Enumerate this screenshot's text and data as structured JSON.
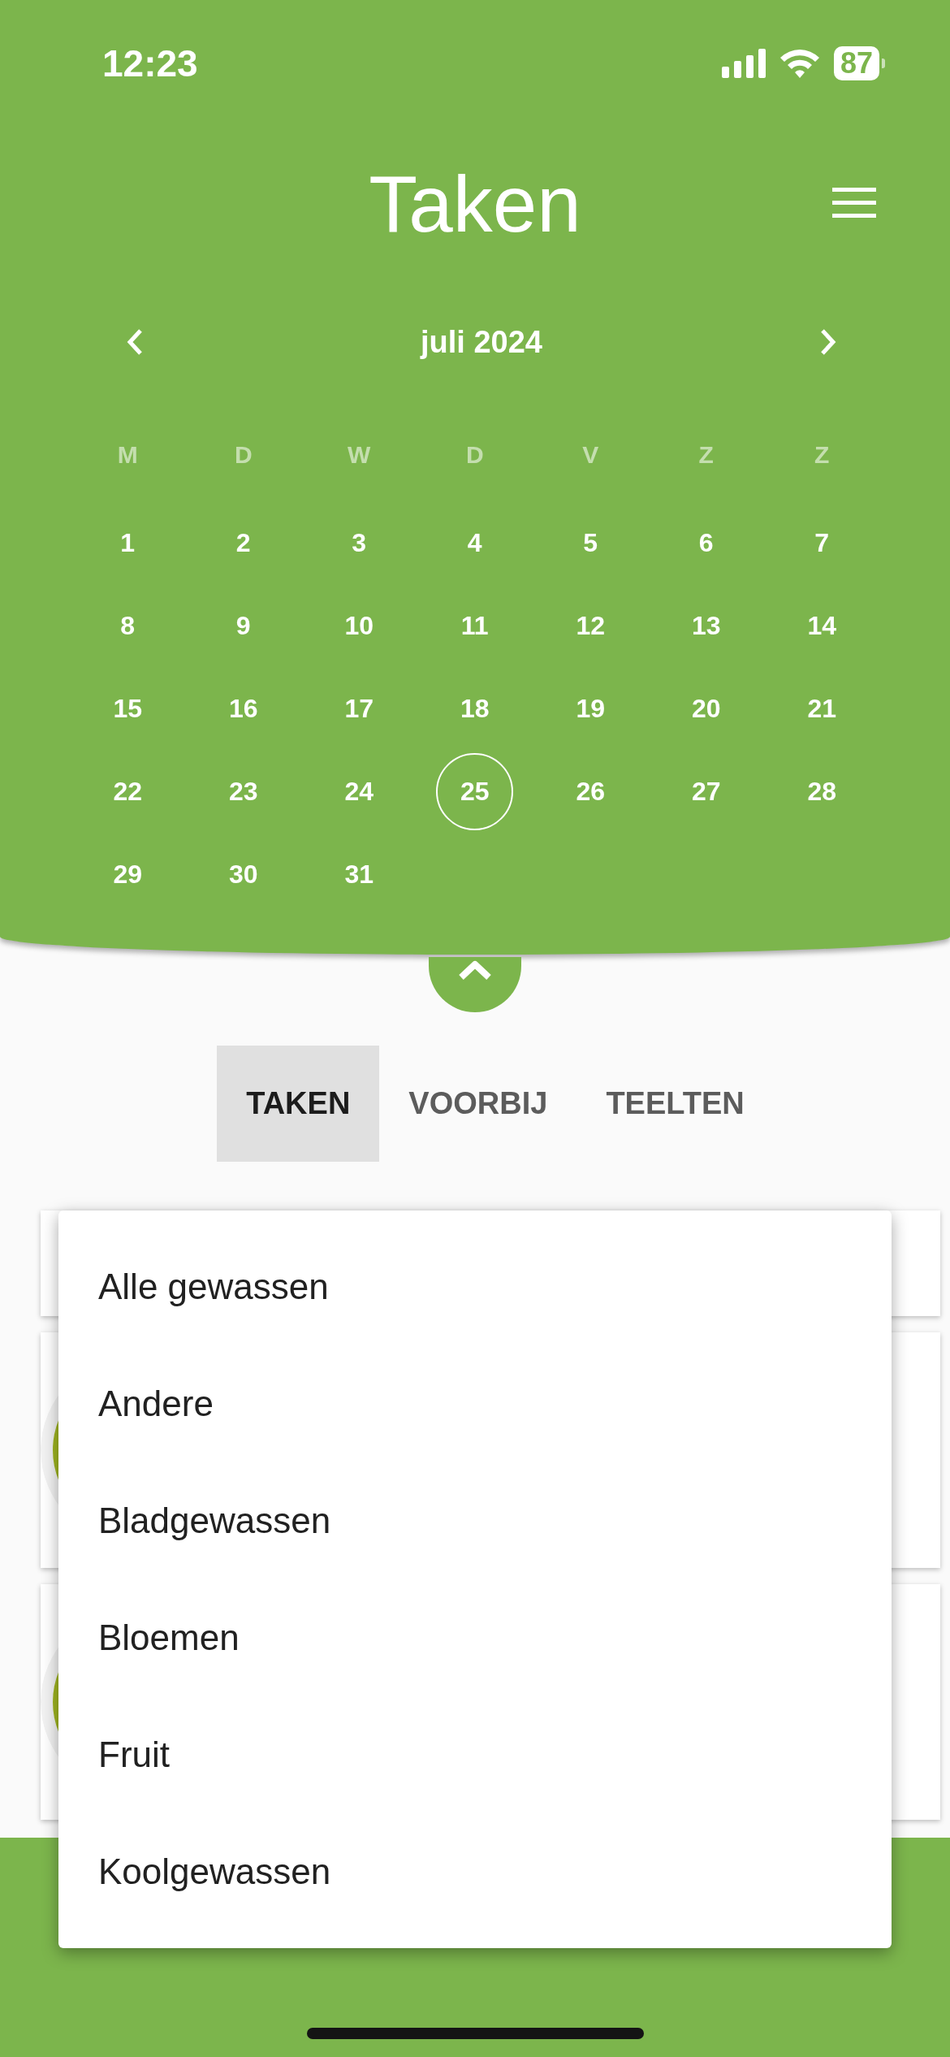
{
  "status_bar": {
    "time": "12:23",
    "battery": "87"
  },
  "header": {
    "title": "Taken"
  },
  "calendar": {
    "month": "juli 2024",
    "weekdays": [
      "M",
      "D",
      "W",
      "D",
      "V",
      "Z",
      "Z"
    ],
    "days": [
      {
        "label": "1",
        "selected": false
      },
      {
        "label": "2",
        "selected": false
      },
      {
        "label": "3",
        "selected": false
      },
      {
        "label": "4",
        "selected": false
      },
      {
        "label": "5",
        "selected": false
      },
      {
        "label": "6",
        "selected": false
      },
      {
        "label": "7",
        "selected": false
      },
      {
        "label": "8",
        "selected": false
      },
      {
        "label": "9",
        "selected": false
      },
      {
        "label": "10",
        "selected": false
      },
      {
        "label": "11",
        "selected": false
      },
      {
        "label": "12",
        "selected": false
      },
      {
        "label": "13",
        "selected": false
      },
      {
        "label": "14",
        "selected": false
      },
      {
        "label": "15",
        "selected": false
      },
      {
        "label": "16",
        "selected": false
      },
      {
        "label": "17",
        "selected": false
      },
      {
        "label": "18",
        "selected": false
      },
      {
        "label": "19",
        "selected": false
      },
      {
        "label": "20",
        "selected": false
      },
      {
        "label": "21",
        "selected": false
      },
      {
        "label": "22",
        "selected": false
      },
      {
        "label": "23",
        "selected": false
      },
      {
        "label": "24",
        "selected": false
      },
      {
        "label": "25",
        "selected": true
      },
      {
        "label": "26",
        "selected": false
      },
      {
        "label": "27",
        "selected": false
      },
      {
        "label": "28",
        "selected": false
      },
      {
        "label": "29",
        "selected": false
      },
      {
        "label": "30",
        "selected": false
      },
      {
        "label": "31",
        "selected": false
      }
    ]
  },
  "tabs": [
    {
      "label": "TAKEN",
      "selected": true
    },
    {
      "label": "VOORBIJ",
      "selected": false
    },
    {
      "label": "TEELTEN",
      "selected": false
    }
  ],
  "dropdown": {
    "options": [
      "Alle gewassen",
      "Andere",
      "Bladgewassen",
      "Bloemen",
      "Fruit",
      "Koolgewassen"
    ]
  }
}
